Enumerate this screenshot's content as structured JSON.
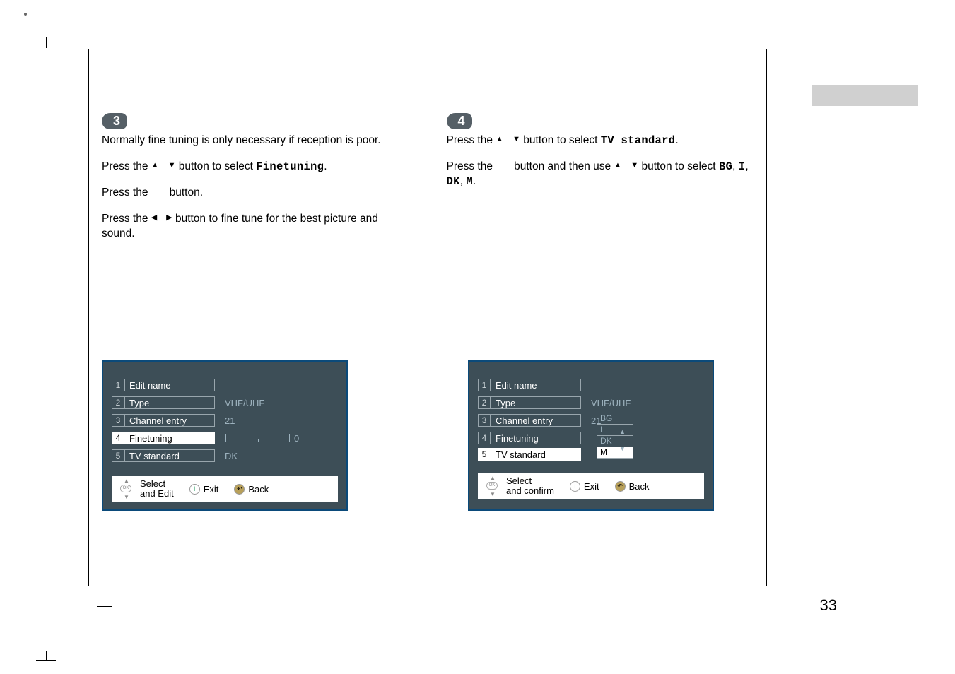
{
  "page_number": "33",
  "left": {
    "step": "3",
    "p1_a": "Normally fine tuning is only necessary if reception is poor.",
    "p2_a": "Press the ",
    "p2_b": " button to select ",
    "p2_bold": "Finetuning",
    "p2_c": ".",
    "p3_a": "Press the ",
    "p3_b": " button.",
    "p4_a": "Press the ",
    "p4_b": " button to fine tune for the best picture and sound."
  },
  "right": {
    "step": "4",
    "p1_a": "Press the ",
    "p1_b": " button to select ",
    "p1_bold": "TV standard",
    "p1_c": ".",
    "p2_a": "Press the ",
    "p2_b": " button and then use ",
    "p2_c": " button to select ",
    "p2_bold1": "BG",
    "p2_s1": ", ",
    "p2_bold2": "I",
    "p2_s2": ", ",
    "p2_bold3": "DK",
    "p2_s3": ", ",
    "p2_bold4": "M",
    "p2_s4": "."
  },
  "osd_left": {
    "items": [
      {
        "n": "1",
        "label": "Edit name",
        "val": ""
      },
      {
        "n": "2",
        "label": "Type",
        "val": "VHF/UHF"
      },
      {
        "n": "3",
        "label": "Channel entry",
        "val": "21"
      },
      {
        "n": "4",
        "label": "Finetuning",
        "val": "0"
      },
      {
        "n": "5",
        "label": "TV standard",
        "val": "DK"
      }
    ],
    "active_index": 3,
    "footer_label_1": "Select",
    "footer_label_2": "and Edit",
    "footer_exit": "Exit",
    "footer_back": "Back"
  },
  "osd_right": {
    "items": [
      {
        "n": "1",
        "label": "Edit name",
        "val": ""
      },
      {
        "n": "2",
        "label": "Type",
        "val": "VHF/UHF"
      },
      {
        "n": "3",
        "label": "Channel entry",
        "val": "21"
      },
      {
        "n": "4",
        "label": "Finetuning",
        "val": ""
      },
      {
        "n": "5",
        "label": "TV standard",
        "val": ""
      }
    ],
    "options": [
      "BG",
      "I",
      "DK",
      "M"
    ],
    "selected_option": "M",
    "active_index": 4,
    "footer_label_1": "Select",
    "footer_label_2": "and confirm",
    "footer_exit": "Exit",
    "footer_back": "Back"
  }
}
